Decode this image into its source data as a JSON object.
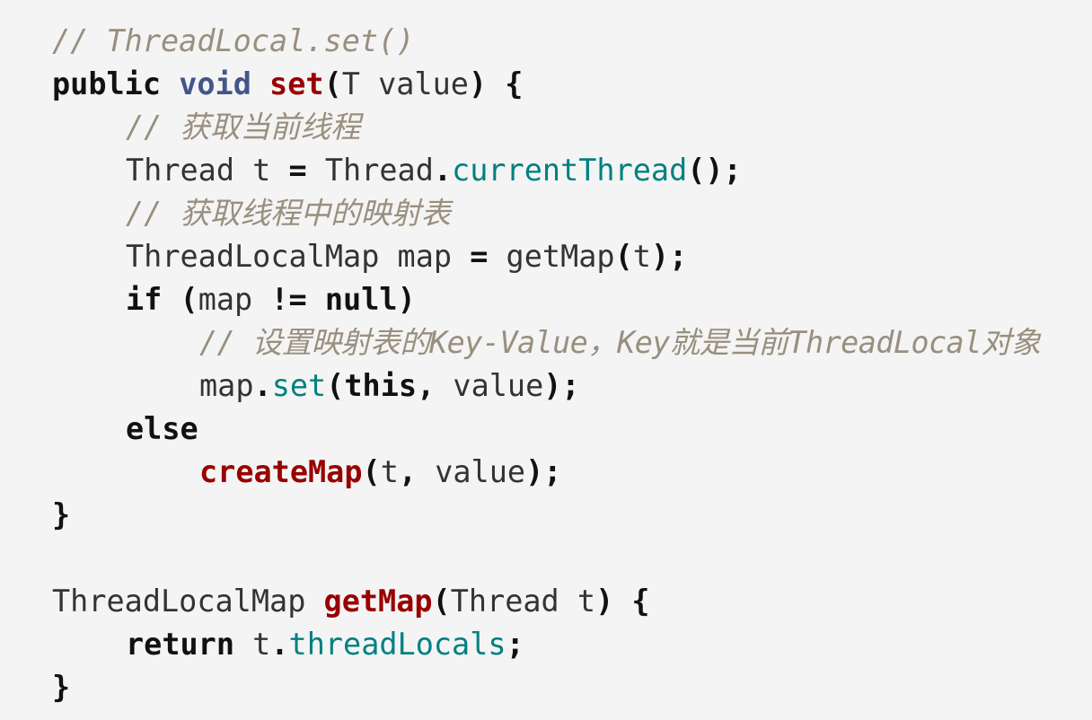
{
  "lines": [
    {
      "indent": 0,
      "tokens": [
        {
          "t": "comment",
          "v": "// ThreadLocal.set()"
        }
      ]
    },
    {
      "indent": 0,
      "tokens": [
        {
          "t": "kw",
          "v": "public"
        },
        {
          "t": "plain",
          "v": " "
        },
        {
          "t": "type",
          "v": "void"
        },
        {
          "t": "plain",
          "v": " "
        },
        {
          "t": "fn",
          "v": "set"
        },
        {
          "t": "punct",
          "v": "("
        },
        {
          "t": "plain",
          "v": "T value"
        },
        {
          "t": "punct",
          "v": ") {"
        }
      ]
    },
    {
      "indent": 1,
      "tokens": [
        {
          "t": "comment",
          "v": "// 获取当前线程"
        }
      ]
    },
    {
      "indent": 1,
      "tokens": [
        {
          "t": "plain",
          "v": "Thread t "
        },
        {
          "t": "punct",
          "v": "="
        },
        {
          "t": "plain",
          "v": " Thread"
        },
        {
          "t": "punct",
          "v": "."
        },
        {
          "t": "member",
          "v": "currentThread"
        },
        {
          "t": "punct",
          "v": "();"
        }
      ]
    },
    {
      "indent": 1,
      "tokens": [
        {
          "t": "comment",
          "v": "// 获取线程中的映射表"
        }
      ]
    },
    {
      "indent": 1,
      "tokens": [
        {
          "t": "plain",
          "v": "ThreadLocalMap map "
        },
        {
          "t": "punct",
          "v": "="
        },
        {
          "t": "plain",
          "v": " getMap"
        },
        {
          "t": "punct",
          "v": "("
        },
        {
          "t": "plain",
          "v": "t"
        },
        {
          "t": "punct",
          "v": ");"
        }
      ]
    },
    {
      "indent": 1,
      "tokens": [
        {
          "t": "kw",
          "v": "if"
        },
        {
          "t": "plain",
          "v": " "
        },
        {
          "t": "punct",
          "v": "("
        },
        {
          "t": "plain",
          "v": "map "
        },
        {
          "t": "punct",
          "v": "!="
        },
        {
          "t": "plain",
          "v": " "
        },
        {
          "t": "kw",
          "v": "null"
        },
        {
          "t": "punct",
          "v": ")"
        }
      ]
    },
    {
      "indent": 2,
      "tokens": [
        {
          "t": "comment wide",
          "v": "// 设置映射表的Key-Value，Key就是当前ThreadLocal对象"
        }
      ]
    },
    {
      "indent": 2,
      "tokens": [
        {
          "t": "plain",
          "v": "map"
        },
        {
          "t": "punct",
          "v": "."
        },
        {
          "t": "member",
          "v": "set"
        },
        {
          "t": "punct",
          "v": "("
        },
        {
          "t": "kw",
          "v": "this"
        },
        {
          "t": "punct",
          "v": ","
        },
        {
          "t": "plain",
          "v": " value"
        },
        {
          "t": "punct",
          "v": ");"
        }
      ]
    },
    {
      "indent": 1,
      "tokens": [
        {
          "t": "kw",
          "v": "else"
        }
      ]
    },
    {
      "indent": 2,
      "tokens": [
        {
          "t": "fn",
          "v": "createMap"
        },
        {
          "t": "punct",
          "v": "("
        },
        {
          "t": "plain",
          "v": "t"
        },
        {
          "t": "punct",
          "v": ","
        },
        {
          "t": "plain",
          "v": " value"
        },
        {
          "t": "punct",
          "v": ");"
        }
      ]
    },
    {
      "indent": 0,
      "tokens": [
        {
          "t": "punct",
          "v": "}"
        }
      ]
    },
    {
      "indent": 0,
      "tokens": []
    },
    {
      "indent": 0,
      "tokens": [
        {
          "t": "plain",
          "v": "ThreadLocalMap "
        },
        {
          "t": "fn",
          "v": "getMap"
        },
        {
          "t": "punct",
          "v": "("
        },
        {
          "t": "plain",
          "v": "Thread t"
        },
        {
          "t": "punct",
          "v": ") {"
        }
      ]
    },
    {
      "indent": 1,
      "tokens": [
        {
          "t": "kw",
          "v": "return"
        },
        {
          "t": "plain",
          "v": " t"
        },
        {
          "t": "punct",
          "v": "."
        },
        {
          "t": "member",
          "v": "threadLocals"
        },
        {
          "t": "punct",
          "v": ";"
        }
      ]
    },
    {
      "indent": 0,
      "tokens": [
        {
          "t": "punct",
          "v": "}"
        }
      ]
    }
  ],
  "colors": {
    "background": "#f4f4f4",
    "comment": "#998f7e",
    "keyword": "#111111",
    "type": "#445588",
    "function": "#990000",
    "member": "#008080",
    "text": "#333333"
  }
}
